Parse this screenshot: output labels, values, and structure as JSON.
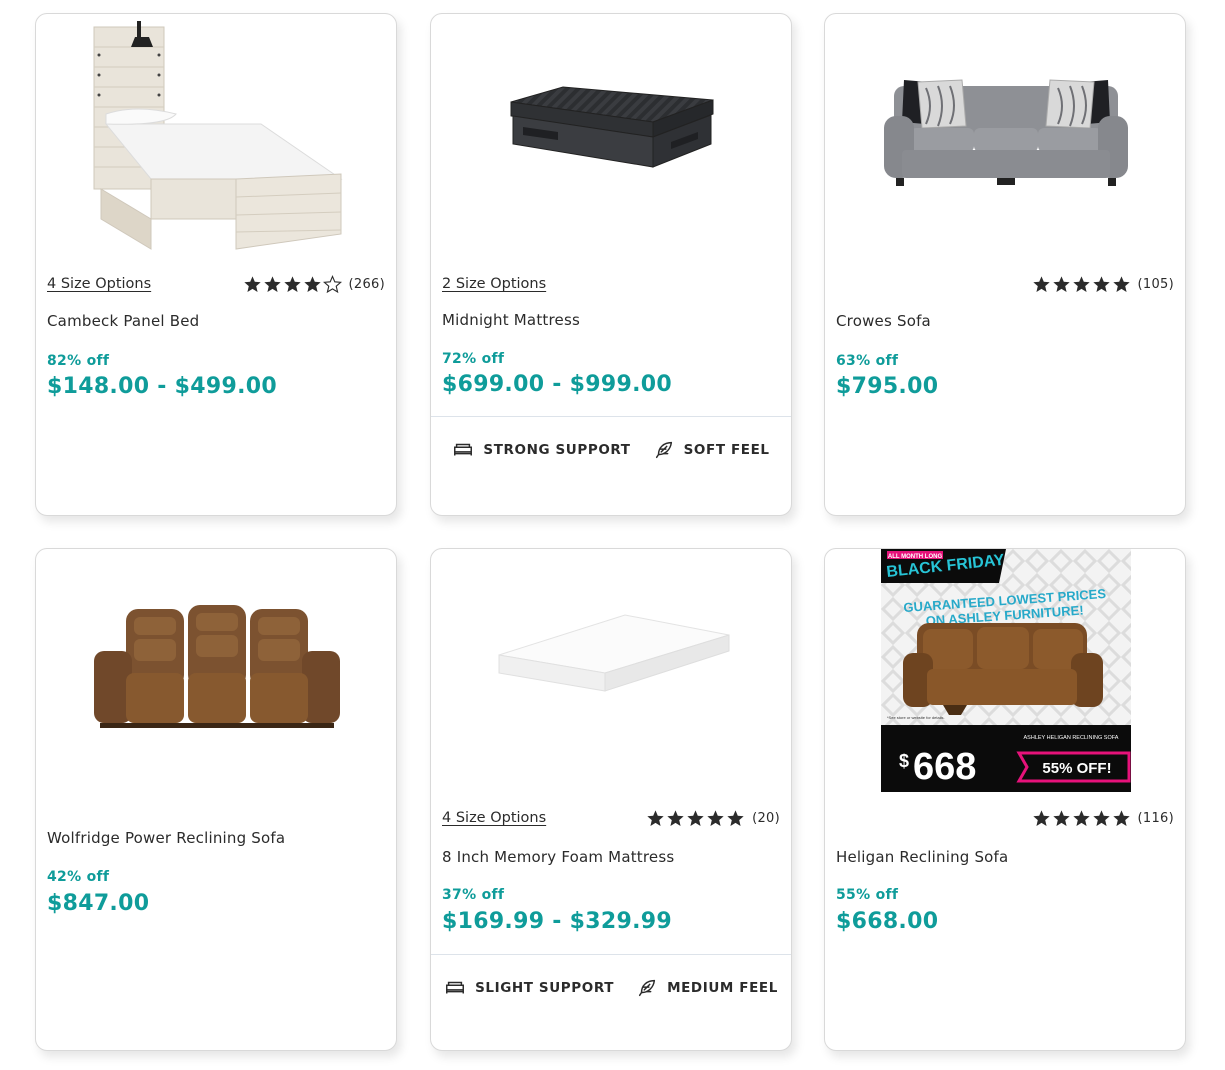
{
  "colors": {
    "accent": "#0f9c9a",
    "text": "#2b2b2b",
    "promo_pink": "#e6127a",
    "promo_cyan": "#27c4d6"
  },
  "products": [
    {
      "name": "Cambeck Panel Bed",
      "size_options": "4 Size Options",
      "stars": 4,
      "reviews": "(266)",
      "discount": "82% off",
      "price": "$148.00 - $499.00",
      "image_icon": "panel-bed-image"
    },
    {
      "name": "Midnight Mattress",
      "size_options": "2 Size Options",
      "discount": "72% off",
      "price": "$699.00 - $999.00",
      "image_icon": "mattress-image",
      "features": [
        {
          "icon": "bed-support-icon",
          "label": "STRONG SUPPORT"
        },
        {
          "icon": "feather-icon",
          "label": "SOFT FEEL"
        }
      ]
    },
    {
      "name": "Crowes Sofa",
      "stars": 5,
      "reviews": "(105)",
      "discount": "63% off",
      "price": "$795.00",
      "image_icon": "sofa-image"
    },
    {
      "name": "Wolfridge Power Reclining Sofa",
      "discount": "42% off",
      "price": "$847.00",
      "image_icon": "reclining-sofa-image"
    },
    {
      "name": "8 Inch Memory Foam Mattress",
      "size_options": "4 Size Options",
      "stars": 5,
      "reviews": "(20)",
      "discount": "37% off",
      "price": "$169.99 - $329.99",
      "image_icon": "foam-mattress-image",
      "features": [
        {
          "icon": "bed-support-icon",
          "label": "SLIGHT SUPPORT"
        },
        {
          "icon": "feather-icon",
          "label": "MEDIUM FEEL"
        }
      ]
    },
    {
      "name": "Heligan Reclining Sofa",
      "stars": 5,
      "reviews": "(116)",
      "discount": "55% off",
      "price": "$668.00",
      "image_icon": "black-friday-promo-image",
      "promo": {
        "tag": "ALL MONTH LONG",
        "headline": "BLACK FRIDAY",
        "line1": "GUARANTEED LOWEST PRICES",
        "line2": "ON ASHLEY FURNITURE!",
        "footnote": "*See store or website for details.",
        "product_label": "ASHLEY HELIGAN RECLINING SOFA",
        "price_symbol": "$",
        "price": "668",
        "off": "55% OFF!"
      }
    }
  ]
}
